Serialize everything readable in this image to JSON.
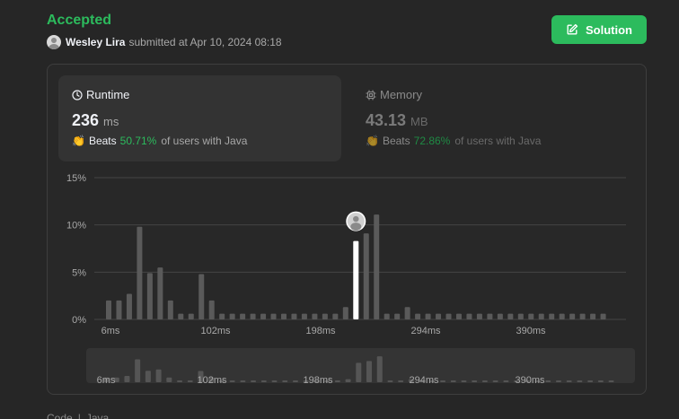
{
  "header": {
    "status": "Accepted",
    "username": "Wesley Lira",
    "submitted_text": "submitted at Apr 10, 2024 08:18",
    "solution_label": "Solution"
  },
  "runtime": {
    "label": "Runtime",
    "value": "236",
    "unit": "ms",
    "beats_label": "Beats",
    "beats_pct": "50.71%",
    "beats_suffix": "of users with Java"
  },
  "memory": {
    "label": "Memory",
    "value": "43.13",
    "unit": "MB",
    "beats_label": "Beats",
    "beats_pct": "72.86%",
    "beats_suffix": "of users with Java"
  },
  "footer": {
    "tab_code": "Code",
    "separator": "|",
    "language": "Java"
  },
  "colors": {
    "accent": "#2cbb5d",
    "bar": "#5a5a5a",
    "highlight_bar": "#ffffff",
    "grid": "#444444"
  },
  "chart_data": {
    "type": "bar",
    "y_ticks": [
      "15%",
      "10%",
      "5%",
      "0%"
    ],
    "ylim": [
      0,
      15
    ],
    "x_tick_labels": [
      "6ms",
      "102ms",
      "198ms",
      "294ms",
      "390ms"
    ],
    "values": [
      2.0,
      2.0,
      2.7,
      9.8,
      4.9,
      5.5,
      2.0,
      0.6,
      0.6,
      4.8,
      2.0,
      0.6,
      0.6,
      0.6,
      0.6,
      0.6,
      0.6,
      0.6,
      0.6,
      0.6,
      0.6,
      0.6,
      0.6,
      1.3,
      8.3,
      9.1,
      11.1,
      0.6,
      0.6,
      1.3,
      0.6,
      0.6,
      0.6,
      0.6,
      0.6,
      0.6,
      0.6,
      0.6,
      0.6,
      0.6,
      0.6,
      0.6,
      0.6,
      0.6,
      0.6,
      0.6,
      0.6,
      0.6,
      0.6
    ],
    "highlight_index": 24,
    "overview_x_tick_labels": [
      "6ms",
      "102ms",
      "198ms",
      "294ms",
      "390ms"
    ]
  }
}
